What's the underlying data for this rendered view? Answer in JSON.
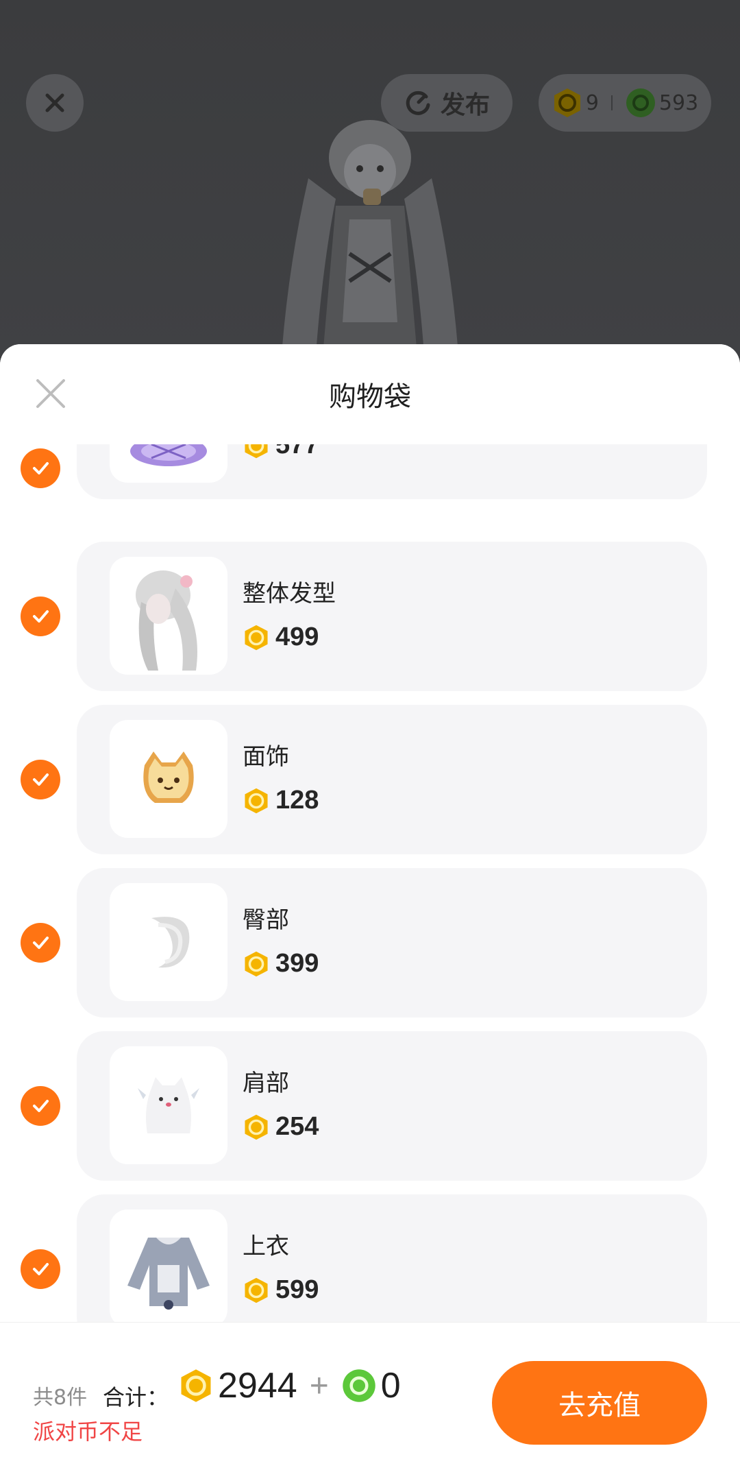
{
  "header": {
    "publish_label": "发布",
    "balance_gold": "9",
    "balance_green": "593"
  },
  "sheet": {
    "title": "购物袋",
    "items": [
      {
        "name": "",
        "price": "577",
        "checked": true
      },
      {
        "name": "整体发型",
        "price": "499",
        "checked": true
      },
      {
        "name": "面饰",
        "price": "128",
        "checked": true
      },
      {
        "name": "臀部",
        "price": "399",
        "checked": true
      },
      {
        "name": "肩部",
        "price": "254",
        "checked": true
      },
      {
        "name": "上衣",
        "price": "599",
        "checked": true
      }
    ]
  },
  "footer": {
    "count": "共8件",
    "total_label": "合计：",
    "total_gold": "2944",
    "plus": "+",
    "total_green": "0",
    "warning": "派对币不足",
    "recharge_label": "去充值"
  },
  "colors": {
    "accent": "#ff7413",
    "gold_coin": "#f5b400",
    "green_coin": "#5cc83a",
    "warning": "#f04545"
  },
  "icons": [
    "close-icon",
    "refresh-publish-icon",
    "gold-coin-icon",
    "green-coin-icon",
    "check-icon"
  ]
}
